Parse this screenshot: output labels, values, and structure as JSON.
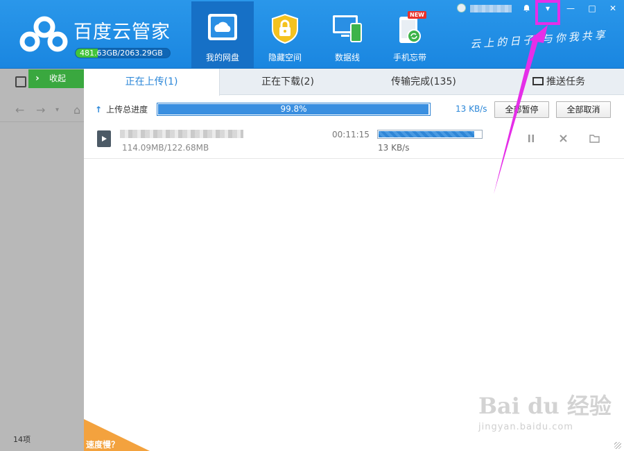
{
  "app": {
    "brand": "百度云管家",
    "quota_text": "481.63GB/2063.29GB",
    "quota_fraction": 0.233
  },
  "nav": {
    "items": [
      {
        "label": "我的网盘",
        "icon": "cloud-icon"
      },
      {
        "label": "隐藏空间",
        "icon": "lock-shield-icon"
      },
      {
        "label": "数据线",
        "icon": "devices-icon"
      },
      {
        "label": "手机忘带",
        "icon": "phone-sync-icon",
        "badge": "NEW"
      }
    ],
    "slogan": "云上的日子 与你我共享"
  },
  "window": {
    "minimize": "—",
    "maximize": "□",
    "close": "✕",
    "menu": "▾"
  },
  "sidebar": {
    "collapse_label": "收起",
    "item_count": "14项"
  },
  "tabs": {
    "uploading": "正在上传(1)",
    "downloading": "正在下载(2)",
    "completed": "传输完成(135)",
    "push": "推送任务"
  },
  "total": {
    "label": "上传总进度",
    "percent_text": "99.8%",
    "percent": 99.8,
    "speed": "13 KB/s",
    "pause_all": "全部暂停",
    "cancel_all": "全部取消"
  },
  "task": {
    "size": "114.09MB/122.68MB",
    "elapsed": "00:11:15",
    "speed": "13 KB/s",
    "progress": 0.93
  },
  "footer": {
    "slow": "速度慢？"
  },
  "watermark": {
    "main": "Bai du 经验",
    "sub": "jingyan.baidu.com"
  },
  "colors": {
    "header": "#1a86e0",
    "accent": "#2a86d8",
    "green": "#3aa83f",
    "orange": "#f3a23e",
    "annotation": "#e52ee8"
  }
}
